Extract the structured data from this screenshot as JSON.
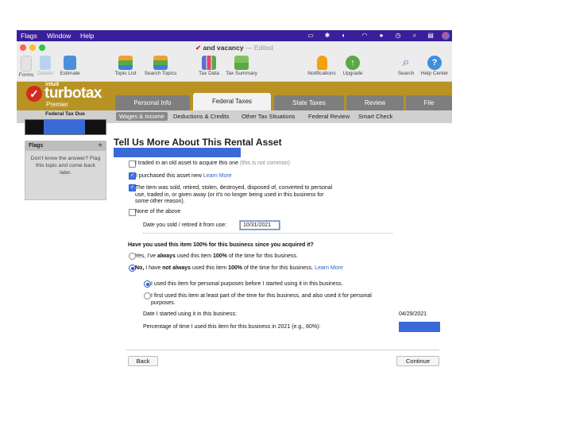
{
  "menubar": {
    "items": [
      "Flags",
      "Window",
      "Help"
    ],
    "status_icons": [
      "screen-icon",
      "bluetooth-icon",
      "audio-icon",
      "wifi-icon",
      "user-icon",
      "clock-icon",
      "search-icon",
      "control-center-icon",
      "siri-icon"
    ]
  },
  "window": {
    "title": "and vacancy",
    "separator": "—",
    "status": "Edited"
  },
  "toolbar": {
    "left": [
      {
        "label": "Forms",
        "icon": "forms-icon"
      },
      {
        "label": "Details",
        "icon": "details-icon"
      },
      {
        "label": "Estimate",
        "icon": "estimate-icon"
      }
    ],
    "center": [
      {
        "label": "Topic List",
        "icon": "topic-list-icon"
      },
      {
        "label": "Search Topics",
        "icon": "search-topics-icon"
      },
      {
        "label": "Tax Data",
        "icon": "tax-data-icon"
      },
      {
        "label": "Tax Summary",
        "icon": "tax-summary-icon"
      }
    ],
    "right": [
      {
        "label": "Notifications",
        "icon": "bell-icon"
      },
      {
        "label": "Upgrade",
        "icon": "upgrade-icon"
      },
      {
        "label": "Search",
        "icon": "search-icon"
      },
      {
        "label": "Help Center",
        "icon": "help-icon"
      }
    ]
  },
  "brand": {
    "company": "intuit",
    "product": "turbotax",
    "edition": "Premier"
  },
  "tabs": [
    "Personal Info",
    "Federal Taxes",
    "State Taxes",
    "Review",
    "File"
  ],
  "federal_tax_due": {
    "label": "Federal Tax Due"
  },
  "subnav": [
    "Wages & Income",
    "Deductions & Credits",
    "Other Tax Situations",
    "Federal Review",
    "Smart Check"
  ],
  "flags": {
    "title": "Flags",
    "add": "+",
    "message": "Don't know the answer? Flag this topic and come back later."
  },
  "main": {
    "title": "Tell Us More About This Rental Asset",
    "options": {
      "traded": {
        "text": "I traded in an old asset to acquire this one",
        "note": "(this is not common)",
        "checked": false
      },
      "purchased": {
        "text": "I purchased this asset new",
        "link": "Learn More",
        "checked": true
      },
      "sold": {
        "text": "The item was sold, retired, stolen, destroyed, disposed of, converted to personal use, traded in, or given away (or it's no longer being used in this business for some other reason).",
        "checked": true
      },
      "none": {
        "text": "None of the above",
        "checked": false
      }
    },
    "date_sold_label": "Date you sold / retired it from use:",
    "date_sold_value": "10/31/2021",
    "question": "Have you used this item 100% for this business since you acquired it?",
    "yes": {
      "pre": "Yes, I've ",
      "b1": "always",
      "mid": " used this item ",
      "b2": "100%",
      "post": " of the time for this business."
    },
    "no": {
      "b0": "No,",
      " pre": "",
      "pre2": " I have ",
      "b1": "not always",
      "mid": " used this item ",
      "b2": "100%",
      "post": " of the time for this business.",
      "link": "Learn More"
    },
    "sub1": "I used this item for personal purposes before I started using it in this business.",
    "sub2": "I first used this item at least part of the time for this business, and also used it for personal purposes.",
    "date_started_label": "Date I started using it in this business:",
    "date_started_value": "04/29/2021",
    "percentage_label": "Percentage of time I used this item for this business in 2021 (e.g., 80%):",
    "back": "Back",
    "continue": "Continue"
  },
  "colors": {
    "menubar": "#3a1f9c",
    "brand": "#b89323",
    "accent": "#3a6ad6",
    "logo": "#d52b1e"
  }
}
